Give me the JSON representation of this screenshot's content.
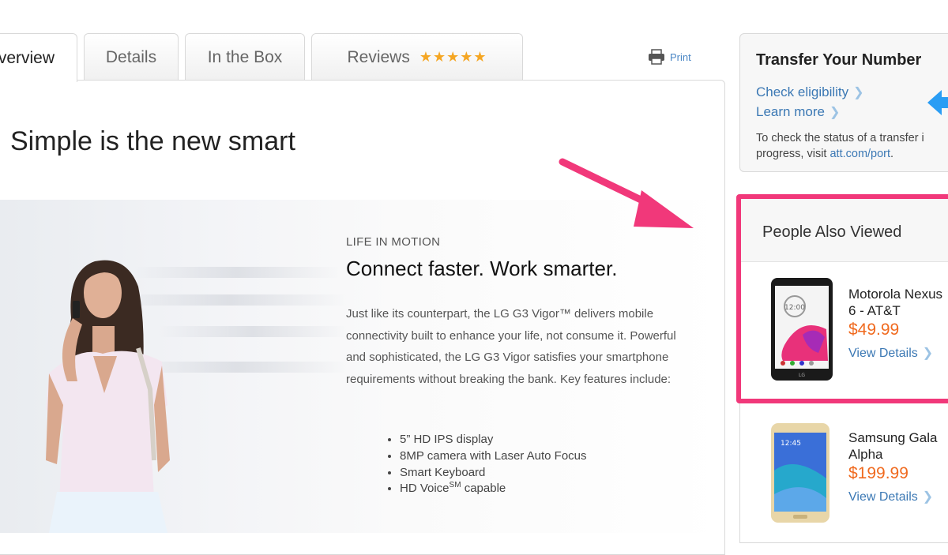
{
  "tabs": [
    {
      "label": "verview",
      "active": true
    },
    {
      "label": "Details",
      "active": false
    },
    {
      "label": "In the Box",
      "active": false
    },
    {
      "label": "Reviews",
      "active": false,
      "rating": 5
    }
  ],
  "print_label": "Print",
  "headline": "Simple is the new smart",
  "hero": {
    "eyebrow": "LIFE IN MOTION",
    "subhead": "Connect faster. Work smarter.",
    "body": "Just like its counterpart, the LG G3 Vigor™ delivers mobile connectivity built to enhance your life, not consume it. Powerful and sophisticated, the LG G3 Vigor satisfies your smartphone requirements without breaking the bank. Key features include:",
    "features": [
      "5” HD IPS display",
      "8MP camera with Laser Auto Focus",
      "Smart Keyboard",
      "HD Voice"
    ],
    "feature_sup": "SM",
    "feature_suffix": " capable"
  },
  "transfer": {
    "title": "Transfer Your Number",
    "links": [
      "Check eligibility",
      "Learn more"
    ],
    "note_prefix": "To check the status of a transfer i",
    "note_line2": "progress, visit ",
    "note_link": "att.com/port",
    "note_end": "."
  },
  "people_also_viewed": {
    "title": "People Also Viewed",
    "items": [
      {
        "name_line1": "Motorola Nexus",
        "name_line2": "6 - AT&T",
        "price": "$49.99",
        "link": "View Details",
        "screen_time": "12:00"
      },
      {
        "name_line1": "Samsung Gala",
        "name_line2": "Alpha",
        "price": "$199.99",
        "link": "View Details",
        "screen_time": "12:45"
      }
    ]
  },
  "colors": {
    "accent_highlight": "#f1387a",
    "link": "#3b78b4",
    "price": "#f06a1f",
    "star": "#f5a623"
  }
}
